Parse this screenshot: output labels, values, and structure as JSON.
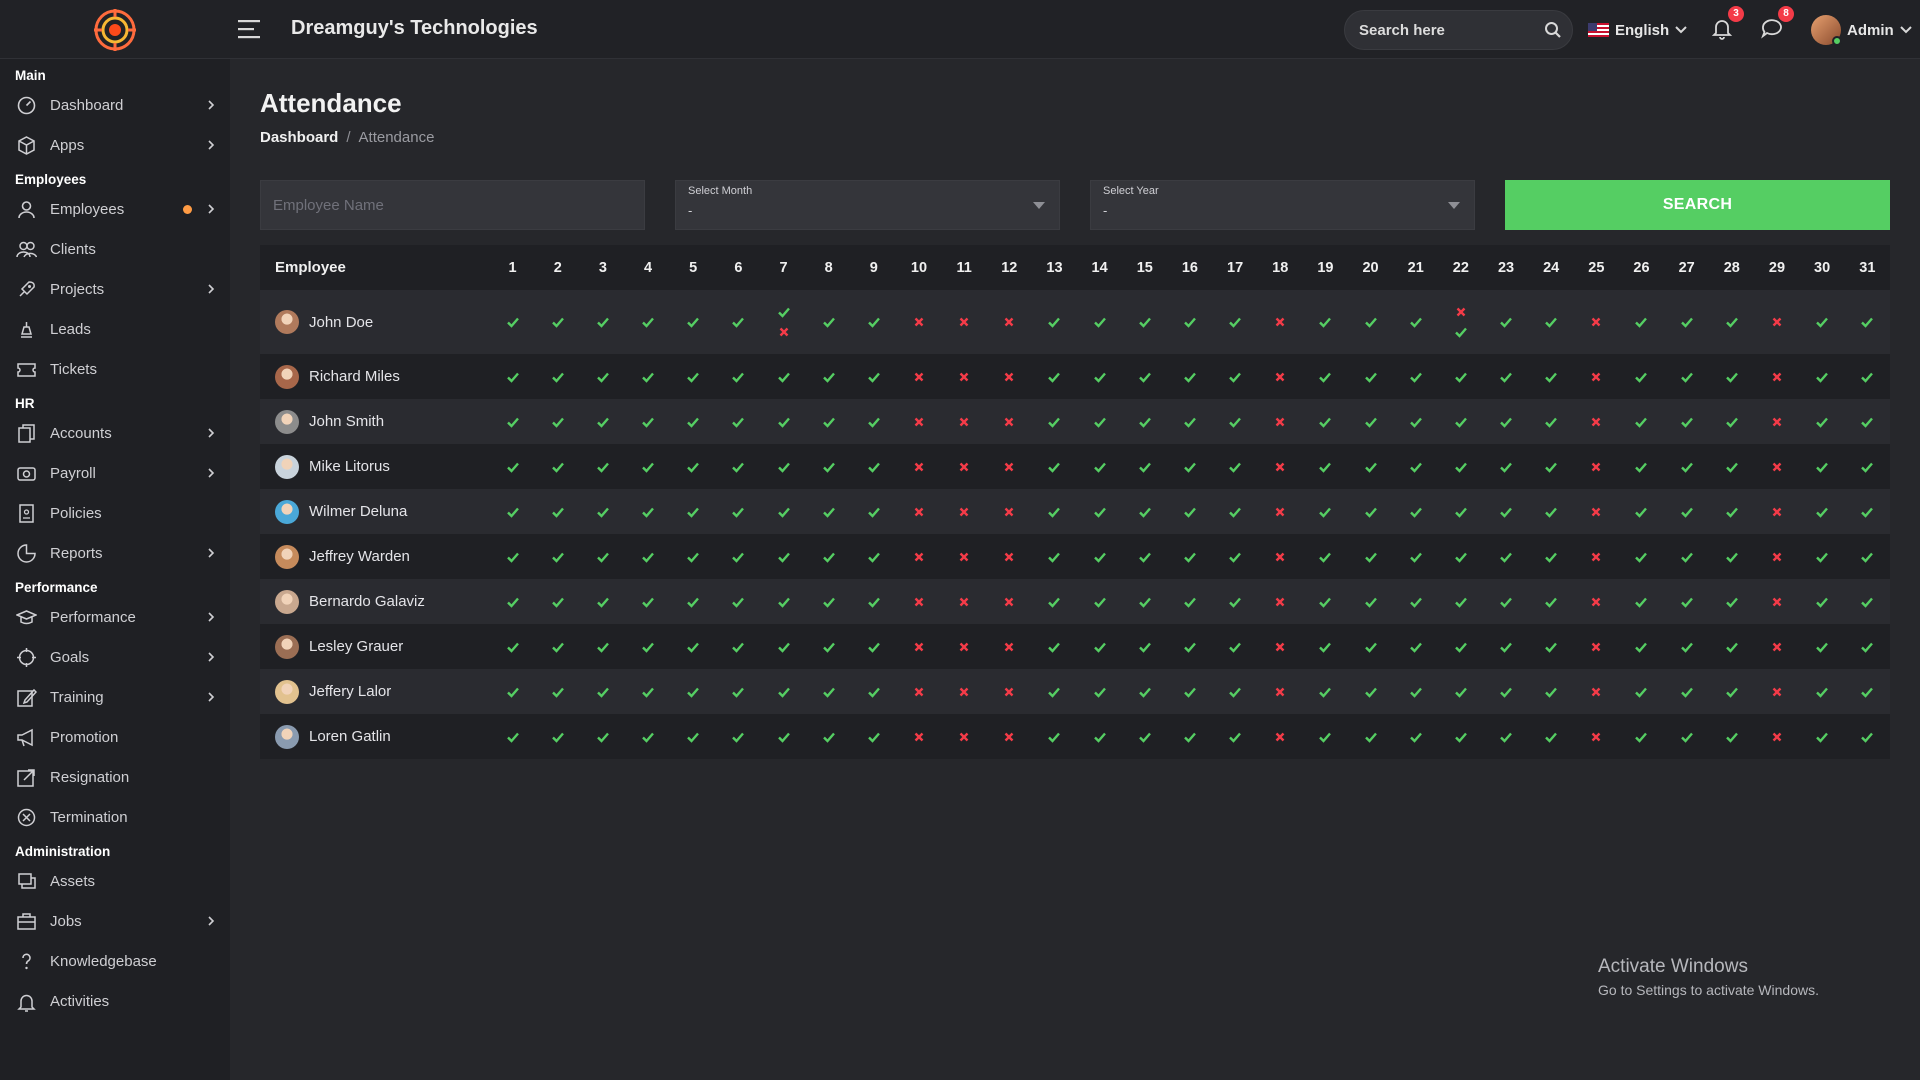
{
  "header": {
    "title": "Dreamguy's Technologies",
    "search_placeholder": "Search here",
    "language": "English",
    "notifications_count": "3",
    "messages_count": "8",
    "user_name": "Admin"
  },
  "sidebar": {
    "sections": [
      {
        "title": "Main",
        "items": [
          {
            "label": "Dashboard",
            "icon": "dashboard-icon",
            "arrow": true
          },
          {
            "label": "Apps",
            "icon": "cube-icon",
            "arrow": true
          }
        ]
      },
      {
        "title": "Employees",
        "items": [
          {
            "label": "Employees",
            "icon": "user-icon",
            "arrow": true,
            "dot": true
          },
          {
            "label": "Clients",
            "icon": "users-icon",
            "arrow": false
          },
          {
            "label": "Projects",
            "icon": "rocket-icon",
            "arrow": true
          },
          {
            "label": "Leads",
            "icon": "chess-icon",
            "arrow": false
          },
          {
            "label": "Tickets",
            "icon": "ticket-icon",
            "arrow": false
          }
        ]
      },
      {
        "title": "HR",
        "items": [
          {
            "label": "Accounts",
            "icon": "files-icon",
            "arrow": true
          },
          {
            "label": "Payroll",
            "icon": "money-icon",
            "arrow": true
          },
          {
            "label": "Policies",
            "icon": "document-icon",
            "arrow": false
          },
          {
            "label": "Reports",
            "icon": "pie-icon",
            "arrow": true
          }
        ]
      },
      {
        "title": "Performance",
        "items": [
          {
            "label": "Performance",
            "icon": "graduation-icon",
            "arrow": true
          },
          {
            "label": "Goals",
            "icon": "crosshair-icon",
            "arrow": true
          },
          {
            "label": "Training",
            "icon": "edit-icon",
            "arrow": true
          },
          {
            "label": "Promotion",
            "icon": "megaphone-icon",
            "arrow": false
          },
          {
            "label": "Resignation",
            "icon": "external-icon",
            "arrow": false
          },
          {
            "label": "Termination",
            "icon": "x-circle-icon",
            "arrow": false
          }
        ]
      },
      {
        "title": "Administration",
        "items": [
          {
            "label": "Assets",
            "icon": "assets-icon",
            "arrow": false
          },
          {
            "label": "Jobs",
            "icon": "briefcase-icon",
            "arrow": true
          },
          {
            "label": "Knowledgebase",
            "icon": "question-icon",
            "arrow": false
          },
          {
            "label": "Activities",
            "icon": "bell-icon",
            "arrow": false
          }
        ]
      }
    ]
  },
  "page": {
    "title": "Attendance",
    "breadcrumb_home": "Dashboard",
    "breadcrumb_sep": "/",
    "breadcrumb_current": "Attendance"
  },
  "filters": {
    "employee_placeholder": "Employee Name",
    "month_label": "Select Month",
    "month_value": "-",
    "year_label": "Select Year",
    "year_value": "-",
    "search_button": "SEARCH"
  },
  "table": {
    "employee_header": "Employee",
    "days": [
      "1",
      "2",
      "3",
      "4",
      "5",
      "6",
      "7",
      "8",
      "9",
      "10",
      "11",
      "12",
      "13",
      "14",
      "15",
      "16",
      "17",
      "18",
      "19",
      "20",
      "21",
      "22",
      "23",
      "24",
      "25",
      "26",
      "27",
      "28",
      "29",
      "30",
      "31"
    ],
    "employees": [
      {
        "name": "John Doe",
        "avatar_color": "#b07a5c"
      },
      {
        "name": "Richard Miles",
        "avatar_color": "#a8674a"
      },
      {
        "name": "John Smith",
        "avatar_color": "#8c8c8c"
      },
      {
        "name": "Mike Litorus",
        "avatar_color": "#c9d3dc"
      },
      {
        "name": "Wilmer Deluna",
        "avatar_color": "#4aa8d8"
      },
      {
        "name": "Jeffrey Warden",
        "avatar_color": "#c68b5c"
      },
      {
        "name": "Bernardo Galaviz",
        "avatar_color": "#c9a88f"
      },
      {
        "name": "Lesley Grauer",
        "avatar_color": "#9b6e54"
      },
      {
        "name": "Jeffery Lalor",
        "avatar_color": "#e2c28f"
      },
      {
        "name": "Loren Gatlin",
        "avatar_color": "#8a9bb0"
      }
    ],
    "absent_days": [
      10,
      11,
      12,
      18,
      25,
      29
    ],
    "special_cells": [
      {
        "row": 0,
        "day": 7,
        "marks": [
          "present",
          "absent"
        ]
      },
      {
        "row": 0,
        "day": 22,
        "marks": [
          "absent",
          "present"
        ]
      }
    ]
  },
  "watermark": {
    "title": "Activate Windows",
    "subtitle": "Go to Settings to activate Windows."
  },
  "colors": {
    "present": "#55ce63",
    "absent": "#f43b48",
    "accent": "#55ce63",
    "badge": "#f43b48"
  }
}
